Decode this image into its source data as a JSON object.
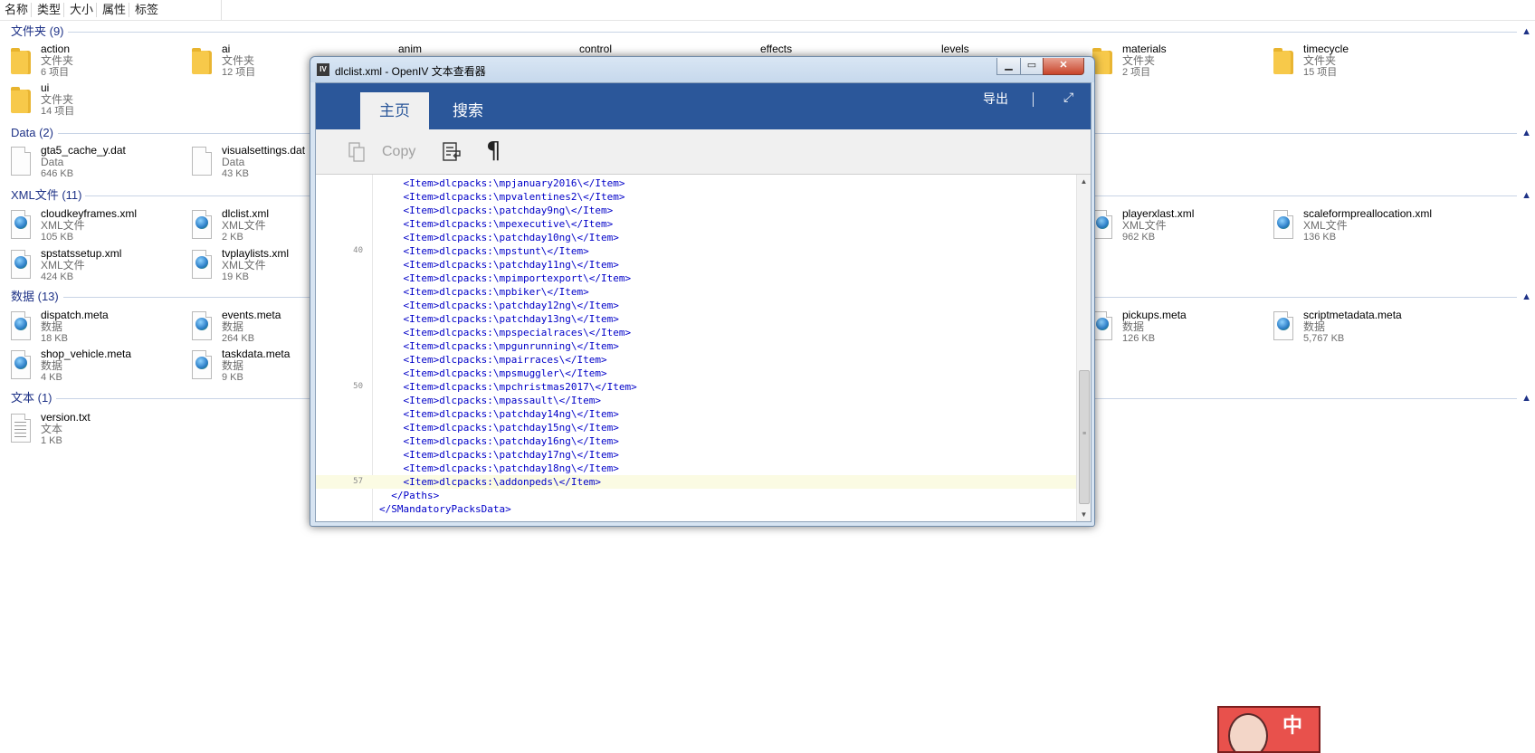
{
  "columns": [
    "名称",
    "类型",
    "大小",
    "属性",
    "标签"
  ],
  "groups": [
    {
      "title": "文件夹 (9)",
      "items": [
        {
          "name": "action",
          "type": "文件夹",
          "size": "6 项目"
        },
        {
          "name": "ai",
          "type": "文件夹",
          "size": "12 项目"
        },
        {
          "name": "anim",
          "type": "",
          "size": ""
        },
        {
          "name": "control",
          "type": "",
          "size": ""
        },
        {
          "name": "effects",
          "type": "",
          "size": ""
        },
        {
          "name": "levels",
          "type": "",
          "size": ""
        },
        {
          "name": "materials",
          "type": "文件夹",
          "size": "2 项目"
        },
        {
          "name": "timecycle",
          "type": "文件夹",
          "size": "15 项目"
        },
        {
          "name": "ui",
          "type": "文件夹",
          "size": "14 项目"
        }
      ]
    },
    {
      "title": "Data (2)",
      "items": [
        {
          "name": "gta5_cache_y.dat",
          "type": "Data",
          "size": "646 KB"
        },
        {
          "name": "visualsettings.dat",
          "type": "Data",
          "size": "43 KB"
        }
      ]
    },
    {
      "title": "XML文件 (11)",
      "items": [
        {
          "name": "cloudkeyframes.xml",
          "type": "XML文件",
          "size": "105 KB"
        },
        {
          "name": "dlclist.xml",
          "type": "XML文件",
          "size": "2 KB"
        },
        {
          "name": "playerxlast.xml",
          "type": "XML文件",
          "size": "962 KB"
        },
        {
          "name": "scaleformpreallocation.xml",
          "type": "XML文件",
          "size": "136 KB"
        },
        {
          "name": "spstatssetup.xml",
          "type": "XML文件",
          "size": "424 KB"
        },
        {
          "name": "tvplaylists.xml",
          "type": "XML文件",
          "size": "19 KB"
        }
      ]
    },
    {
      "title": "数据 (13)",
      "items": [
        {
          "name": "dispatch.meta",
          "type": "数据",
          "size": "18 KB"
        },
        {
          "name": "events.meta",
          "type": "数据",
          "size": "264 KB"
        },
        {
          "name": "pickups.meta",
          "type": "数据",
          "size": "126 KB"
        },
        {
          "name": "scriptmetadata.meta",
          "type": "数据",
          "size": "5,767 KB"
        },
        {
          "name": "shop_vehicle.meta",
          "type": "数据",
          "size": "4 KB"
        },
        {
          "name": "taskdata.meta",
          "type": "数据",
          "size": "9 KB"
        }
      ]
    },
    {
      "title": "文本 (1)",
      "items": [
        {
          "name": "version.txt",
          "type": "文本",
          "size": "1 KB"
        }
      ]
    }
  ],
  "viewer": {
    "app_badge": "IV",
    "title": "dlclist.xml - OpenIV 文本查看器",
    "tabs": [
      "主页",
      "搜索"
    ],
    "export_label": "导出",
    "copy_label": "Copy",
    "pilcrow": "¶",
    "lines": [
      {
        "num": "",
        "code": "    <Item>dlcpacks:\\mpjanuary2016\\</Item>"
      },
      {
        "num": "",
        "code": "    <Item>dlcpacks:\\mpvalentines2\\</Item>"
      },
      {
        "num": "",
        "code": "    <Item>dlcpacks:\\patchday9ng\\</Item>"
      },
      {
        "num": "",
        "code": "    <Item>dlcpacks:\\mpexecutive\\</Item>"
      },
      {
        "num": "",
        "code": "    <Item>dlcpacks:\\patchday10ng\\</Item>"
      },
      {
        "num": "40",
        "code": "    <Item>dlcpacks:\\mpstunt\\</Item>"
      },
      {
        "num": "",
        "code": "    <Item>dlcpacks:\\patchday11ng\\</Item>"
      },
      {
        "num": "",
        "code": "    <Item>dlcpacks:\\mpimportexport\\</Item>"
      },
      {
        "num": "",
        "code": "    <Item>dlcpacks:\\mpbiker\\</Item>"
      },
      {
        "num": "",
        "code": "    <Item>dlcpacks:\\patchday12ng\\</Item>"
      },
      {
        "num": "",
        "code": "    <Item>dlcpacks:\\patchday13ng\\</Item>"
      },
      {
        "num": "",
        "code": "    <Item>dlcpacks:\\mpspecialraces\\</Item>"
      },
      {
        "num": "",
        "code": "    <Item>dlcpacks:\\mpgunrunning\\</Item>"
      },
      {
        "num": "",
        "code": "    <Item>dlcpacks:\\mpairraces\\</Item>"
      },
      {
        "num": "",
        "code": "    <Item>dlcpacks:\\mpsmuggler\\</Item>"
      },
      {
        "num": "50",
        "code": "    <Item>dlcpacks:\\mpchristmas2017\\</Item>"
      },
      {
        "num": "",
        "code": "    <Item>dlcpacks:\\mpassault\\</Item>"
      },
      {
        "num": "",
        "code": "    <Item>dlcpacks:\\patchday14ng\\</Item>"
      },
      {
        "num": "",
        "code": "    <Item>dlcpacks:\\patchday15ng\\</Item>"
      },
      {
        "num": "",
        "code": "    <Item>dlcpacks:\\patchday16ng\\</Item>"
      },
      {
        "num": "",
        "code": "    <Item>dlcpacks:\\patchday17ng\\</Item>"
      },
      {
        "num": "",
        "code": "    <Item>dlcpacks:\\patchday18ng\\</Item>"
      },
      {
        "num": "57",
        "code": "    <Item>dlcpacks:\\addonpeds\\</Item>"
      },
      {
        "num": "",
        "code": "  </Paths>"
      },
      {
        "num": "",
        "code": "</SMandatoryPacksData>"
      }
    ],
    "current_line_index": 22
  },
  "sticker": {
    "text": "中"
  }
}
